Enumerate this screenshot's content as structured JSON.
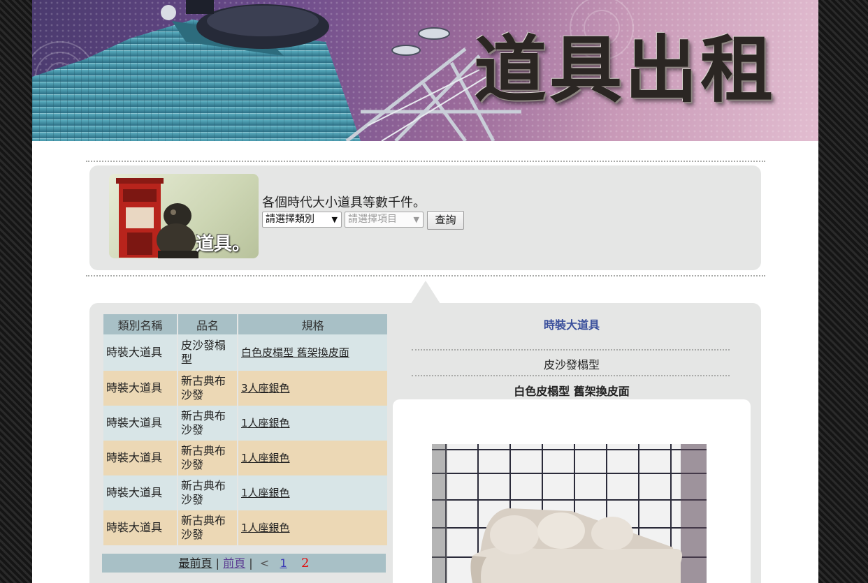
{
  "banner": {
    "title": "道具出租"
  },
  "promo": {
    "thumb_caption": "道具。",
    "description": "各個時代大小道具等數千件。"
  },
  "search": {
    "category_select": "請選擇類別",
    "item_select": "請選擇項目",
    "query_button": "查詢"
  },
  "table": {
    "headers": [
      "類別名稱",
      "品名",
      "規格"
    ],
    "rows": [
      {
        "category": "時裝大道具",
        "name": "皮沙發榻型",
        "spec": "白色皮榻型 舊架換皮面"
      },
      {
        "category": "時裝大道具",
        "name": "新古典布沙發",
        "spec": "3人座銀色"
      },
      {
        "category": "時裝大道具",
        "name": "新古典布沙發",
        "spec": "1人座銀色"
      },
      {
        "category": "時裝大道具",
        "name": "新古典布沙發",
        "spec": "1人座銀色"
      },
      {
        "category": "時裝大道具",
        "name": "新古典布沙發",
        "spec": "1人座銀色"
      },
      {
        "category": "時裝大道具",
        "name": "新古典布沙發",
        "spec": "1人座銀色"
      }
    ]
  },
  "pager": {
    "first": "最前頁",
    "sep1": "|",
    "prev": "前頁",
    "sep2": "|",
    "arrow": "<",
    "page1": "1",
    "page2": "2"
  },
  "detail": {
    "category": "時裝大道具",
    "name": "皮沙發榻型",
    "spec": "白色皮榻型 舊架換皮面"
  },
  "colors": {
    "header_bg": "#a8c0c6",
    "row_even": "#d8e5e7",
    "row_odd": "#ecd8b5",
    "panel_bg": "#e5e6e5",
    "accent_blue": "#3a4f9c"
  }
}
